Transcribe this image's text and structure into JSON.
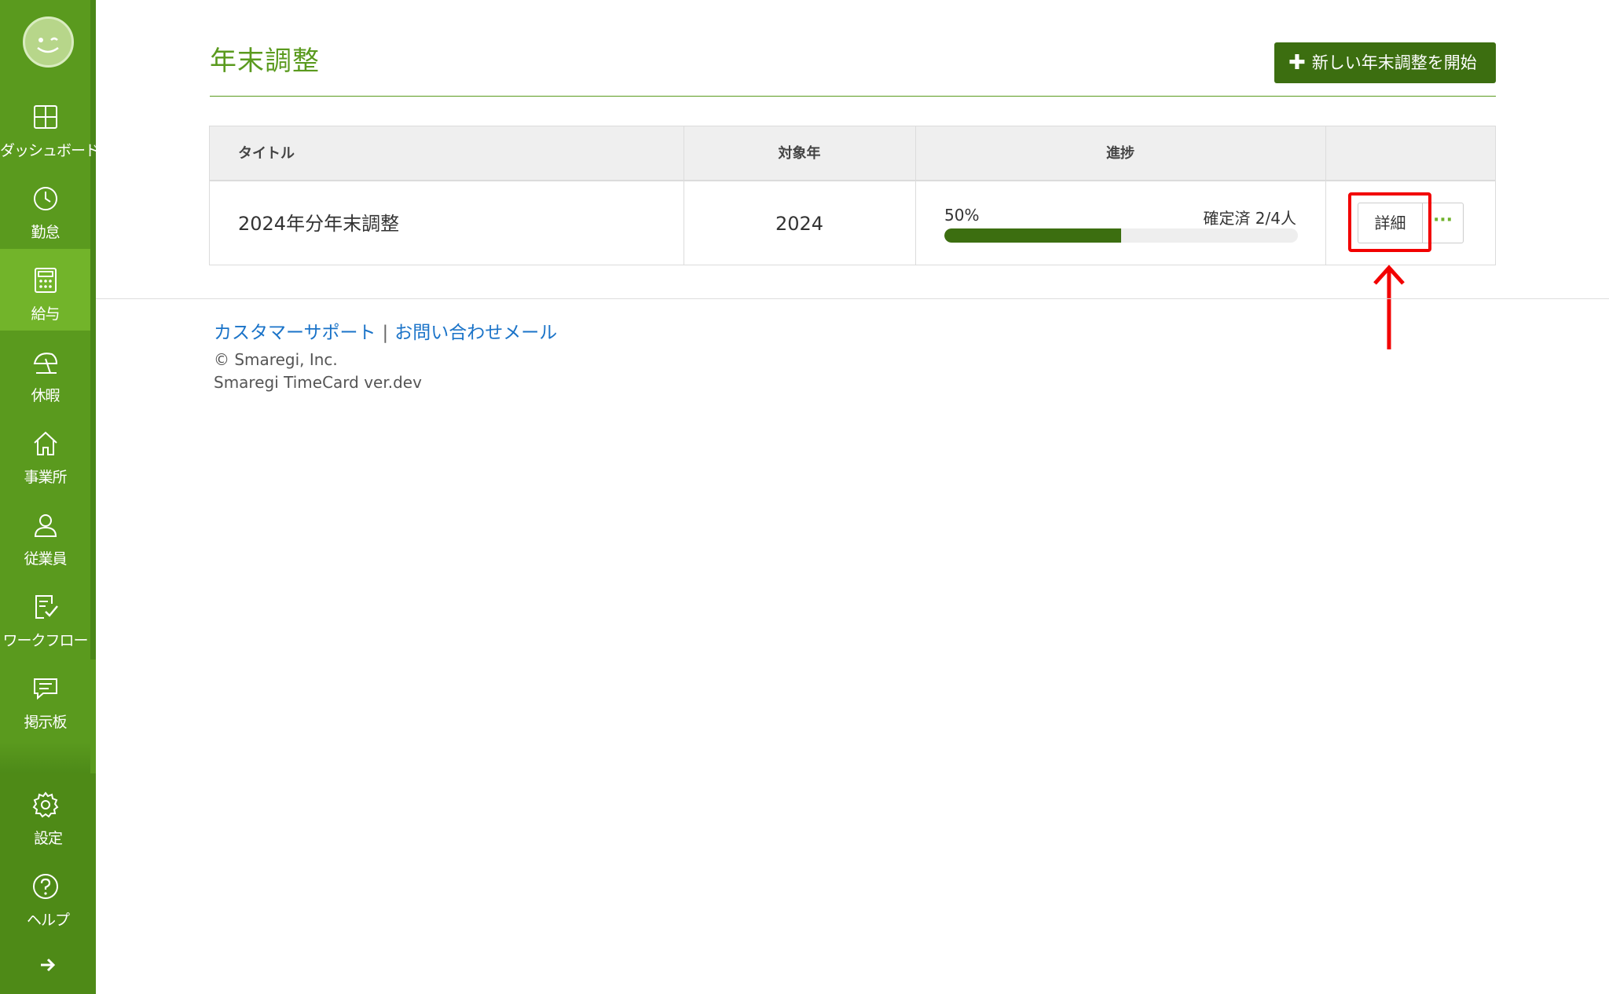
{
  "sidebar": {
    "items": [
      {
        "label": "ダッシュボード",
        "icon": "dashboard-icon"
      },
      {
        "label": "勤怠",
        "icon": "clock-icon"
      },
      {
        "label": "給与",
        "icon": "calculator-icon",
        "active": true
      },
      {
        "label": "休暇",
        "icon": "umbrella-icon"
      },
      {
        "label": "事業所",
        "icon": "home-icon"
      },
      {
        "label": "従業員",
        "icon": "person-icon"
      },
      {
        "label": "ワークフロー",
        "icon": "checklist-icon"
      },
      {
        "label": "掲示板",
        "icon": "chat-icon"
      }
    ],
    "bottom_items": [
      {
        "label": "設定",
        "icon": "gear-icon"
      },
      {
        "label": "ヘルプ",
        "icon": "help-icon"
      }
    ],
    "collapse_icon": "arrow-right-icon",
    "colors": {
      "background": "#5a9a1e",
      "active": "#72b42a",
      "bottom": "#4e8a17"
    }
  },
  "header": {
    "title": "年末調整",
    "new_button_label": "新しい年末調整を開始"
  },
  "table": {
    "columns": [
      "タイトル",
      "対象年",
      "進捗",
      ""
    ],
    "rows": [
      {
        "title": "2024年分年末調整",
        "year": "2024",
        "progress_percent_label": "50%",
        "progress_fraction": 0.5,
        "progress_count_label": "確定済 2/4人",
        "detail_label": "詳細",
        "more_label": "···"
      }
    ]
  },
  "footer": {
    "support_link": "カスタマーサポート",
    "separator": "|",
    "contact_link": "お問い合わせメール",
    "copyright": "© Smaregi, Inc.",
    "version": "Smaregi TimeCard ver.dev"
  },
  "colors": {
    "accent": "#5a9a1e",
    "button": "#3c6e10",
    "link": "#1a73c8",
    "highlight": "#f20000"
  }
}
